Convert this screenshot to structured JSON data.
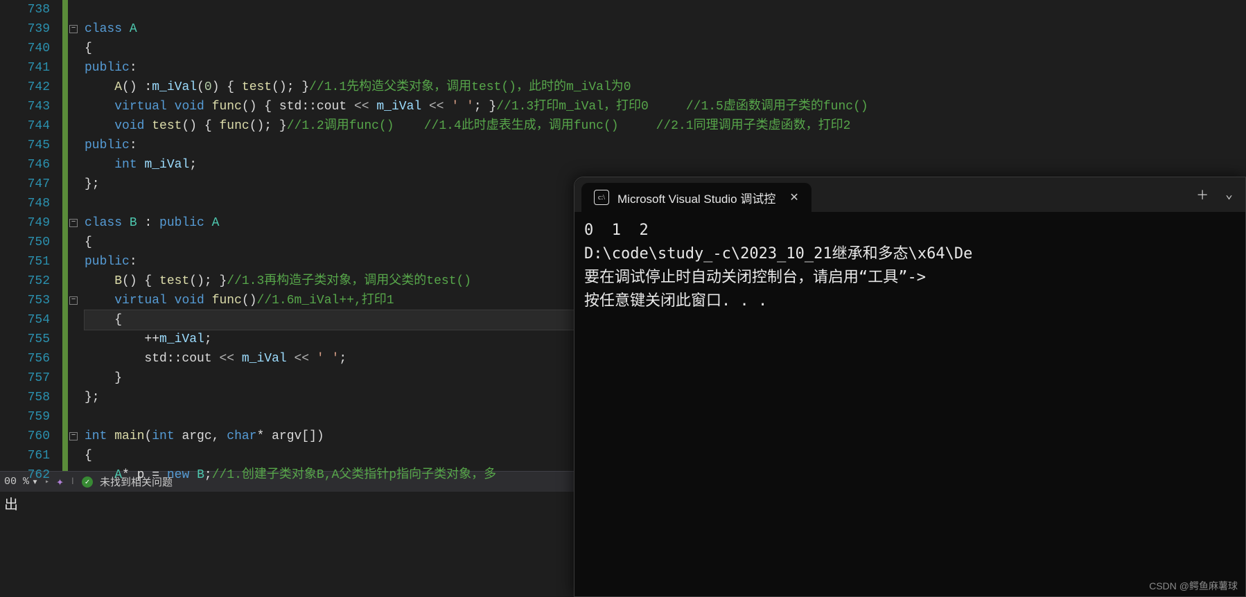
{
  "gutter": {
    "start": 738,
    "end": 762
  },
  "code": {
    "lines": [
      [],
      [
        [
          "kw",
          "class"
        ],
        [
          "id",
          " "
        ],
        [
          "ty",
          "A"
        ]
      ],
      [
        [
          "id",
          "{"
        ]
      ],
      [
        [
          "kw",
          "public"
        ],
        [
          "id",
          ":"
        ]
      ],
      [
        [
          "id",
          "    "
        ],
        [
          "fn",
          "A"
        ],
        [
          "id",
          "() :"
        ],
        [
          "mv",
          "m_iVal"
        ],
        [
          "id",
          "("
        ],
        [
          "nm",
          "0"
        ],
        [
          "id",
          ") { "
        ],
        [
          "fn",
          "test"
        ],
        [
          "id",
          "(); }"
        ],
        [
          "cm",
          "//1.1先构造父类对象，调用test()，此时的m_iVal为0"
        ]
      ],
      [
        [
          "id",
          "    "
        ],
        [
          "kw",
          "virtual"
        ],
        [
          "id",
          " "
        ],
        [
          "kw",
          "void"
        ],
        [
          "id",
          " "
        ],
        [
          "fn",
          "func"
        ],
        [
          "id",
          "() { std::cout "
        ],
        [
          "op",
          "<<"
        ],
        [
          "id",
          " "
        ],
        [
          "mv",
          "m_iVal"
        ],
        [
          "id",
          " "
        ],
        [
          "op",
          "<<"
        ],
        [
          "id",
          " "
        ],
        [
          "str",
          "' '"
        ],
        [
          "id",
          "; }"
        ],
        [
          "cm",
          "//1.3打印m_iVal，打印0     //1.5虚函数调用子类的func()"
        ]
      ],
      [
        [
          "id",
          "    "
        ],
        [
          "kw",
          "void"
        ],
        [
          "id",
          " "
        ],
        [
          "fn",
          "test"
        ],
        [
          "id",
          "() { "
        ],
        [
          "fn",
          "func"
        ],
        [
          "id",
          "(); }"
        ],
        [
          "cm",
          "//1.2调用func()    //1.4此时虚表生成，调用func()     //2.1同理调用子类虚函数，打印2"
        ]
      ],
      [
        [
          "kw",
          "public"
        ],
        [
          "id",
          ":"
        ]
      ],
      [
        [
          "id",
          "    "
        ],
        [
          "kw",
          "int"
        ],
        [
          "id",
          " "
        ],
        [
          "mv",
          "m_iVal"
        ],
        [
          "id",
          ";"
        ]
      ],
      [
        [
          "id",
          "};"
        ]
      ],
      [],
      [
        [
          "kw",
          "class"
        ],
        [
          "id",
          " "
        ],
        [
          "ty",
          "B"
        ],
        [
          "id",
          " : "
        ],
        [
          "kw",
          "public"
        ],
        [
          "id",
          " "
        ],
        [
          "ty",
          "A"
        ]
      ],
      [
        [
          "id",
          "{"
        ]
      ],
      [
        [
          "kw",
          "public"
        ],
        [
          "id",
          ":"
        ]
      ],
      [
        [
          "id",
          "    "
        ],
        [
          "fn",
          "B"
        ],
        [
          "id",
          "() { "
        ],
        [
          "fn",
          "test"
        ],
        [
          "id",
          "(); }"
        ],
        [
          "cm",
          "//1.3再构造子类对象，调用父类的test()"
        ]
      ],
      [
        [
          "id",
          "    "
        ],
        [
          "kw",
          "virtual"
        ],
        [
          "id",
          " "
        ],
        [
          "kw",
          "void"
        ],
        [
          "id",
          " "
        ],
        [
          "fn",
          "func"
        ],
        [
          "id",
          "()"
        ],
        [
          "cm",
          "//1.6m_iVal++,打印1"
        ]
      ],
      [
        [
          "id",
          "    {"
        ]
      ],
      [
        [
          "id",
          "        ++"
        ],
        [
          "mv",
          "m_iVal"
        ],
        [
          "id",
          ";"
        ]
      ],
      [
        [
          "id",
          "        std::cout "
        ],
        [
          "op",
          "<<"
        ],
        [
          "id",
          " "
        ],
        [
          "mv",
          "m_iVal"
        ],
        [
          "id",
          " "
        ],
        [
          "op",
          "<<"
        ],
        [
          "id",
          " "
        ],
        [
          "str",
          "' '"
        ],
        [
          "id",
          ";"
        ]
      ],
      [
        [
          "id",
          "    }"
        ]
      ],
      [
        [
          "id",
          "};"
        ]
      ],
      [],
      [
        [
          "kw",
          "int"
        ],
        [
          "id",
          " "
        ],
        [
          "fn",
          "main"
        ],
        [
          "id",
          "("
        ],
        [
          "kw",
          "int"
        ],
        [
          "id",
          " argc, "
        ],
        [
          "kw",
          "char"
        ],
        [
          "id",
          "* argv[])"
        ]
      ],
      [
        [
          "id",
          "{"
        ]
      ],
      [
        [
          "id",
          "    "
        ],
        [
          "ty",
          "A"
        ],
        [
          "id",
          "* p = "
        ],
        [
          "kw",
          "new"
        ],
        [
          "id",
          " "
        ],
        [
          "ty",
          "B"
        ],
        [
          "id",
          ";"
        ],
        [
          "cm",
          "//1.创建子类对象B,A父类指针p指向子类对象，多"
        ]
      ]
    ],
    "fold_rows": [
      1,
      11,
      15,
      22
    ],
    "highlight_row": 16
  },
  "status": {
    "zoom": "00 %",
    "issues": "未找到相关问题"
  },
  "output_label": "出",
  "console": {
    "tab_title": "Microsoft Visual Studio 调试控",
    "tab_icon": "c:\\",
    "body": "0  1  2\nD:\\code\\study_-c\\2023_10_21继承和多态\\x64\\De\n要在调试停止时自动关闭控制台，请启用“工具”->\n按任意键关闭此窗口. . ."
  },
  "watermark": "CSDN @鳄鱼麻薯球"
}
